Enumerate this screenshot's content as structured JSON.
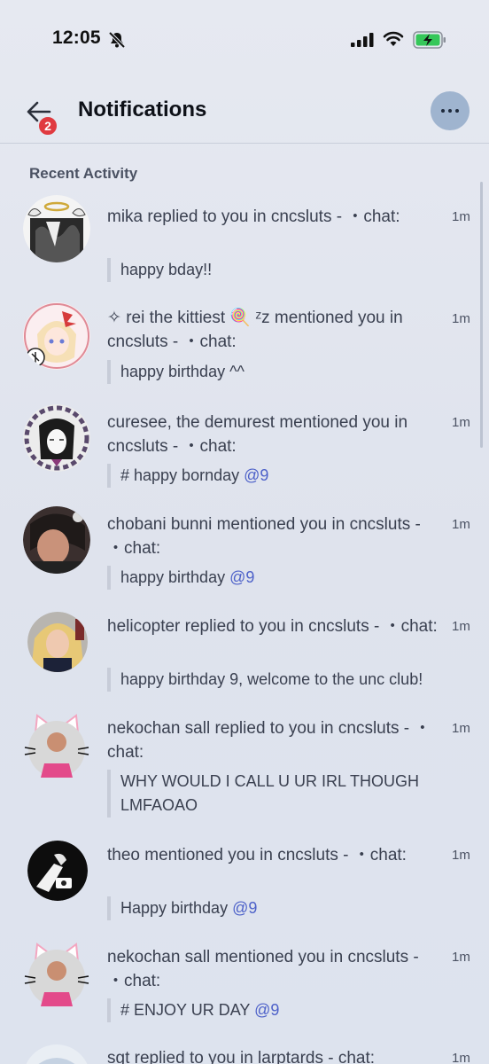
{
  "status_bar": {
    "time": "12:05"
  },
  "header": {
    "title": "Notifications",
    "back_badge": "2"
  },
  "section": {
    "title": "Recent Activity"
  },
  "notifications": [
    {
      "text": "mika replied to you in cncsluts - ・chat:",
      "time": "1m",
      "quote": "happy bday!!",
      "mention": "",
      "avatar": "mika-avatar"
    },
    {
      "text": "✧ rei the kittiest 🍭 ᶻz mentioned you in cncsluts - ・chat:",
      "time": "1m",
      "quote": "happy birthday ^^",
      "mention": "",
      "avatar": "rei-avatar"
    },
    {
      "text": "curesee, the demurest mentioned you in cncsluts - ・chat:",
      "time": "1m",
      "quote": "# happy bornday ",
      "mention": "@9",
      "avatar": "curesee-avatar"
    },
    {
      "text": "chobani bunni mentioned you in cncsluts - ・chat:",
      "time": "1m",
      "quote": "happy birthday ",
      "mention": "@9",
      "avatar": "chobani-avatar"
    },
    {
      "text": "helicopter replied to you in cncsluts - ・chat:",
      "time": "1m",
      "quote": "happy birthday 9, welcome to the unc club!",
      "mention": "",
      "avatar": "helicopter-avatar"
    },
    {
      "text": "nekochan sall replied to you in cncsluts - ・chat:",
      "time": "1m",
      "quote": "WHY WOULD I CALL U UR IRL THOUGH LMFAOAO",
      "mention": "",
      "avatar": "nekochan-avatar"
    },
    {
      "text": "theo mentioned you in cncsluts - ・chat:",
      "time": "1m",
      "quote": "Happy birthday ",
      "mention": "@9",
      "avatar": "theo-avatar"
    },
    {
      "text": "nekochan sall mentioned you in cncsluts - ・chat:",
      "time": "1m",
      "quote": "# ENJOY UR DAY ",
      "mention": "@9",
      "avatar": "nekochan-avatar"
    },
    {
      "text": "sgt replied to you in larptards - chat:",
      "time": "1m",
      "quote": "",
      "mention": "",
      "avatar": "sgt-avatar"
    }
  ]
}
